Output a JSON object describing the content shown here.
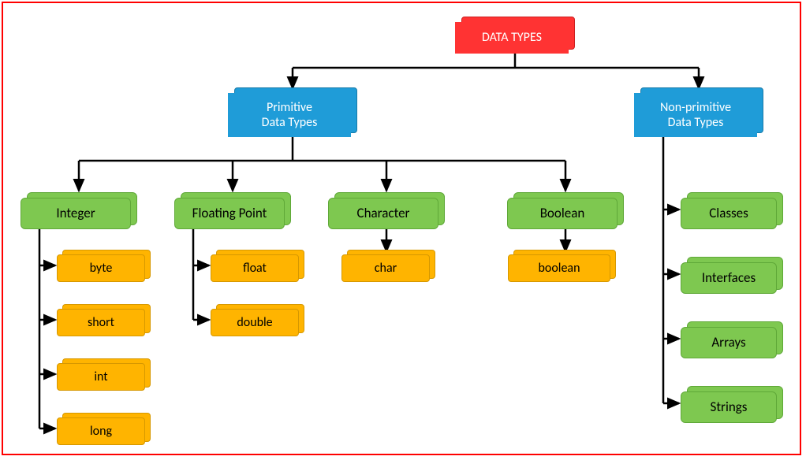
{
  "root": {
    "label": "DATA TYPES"
  },
  "primitive": {
    "label": "Primitive\nData Types",
    "integer": {
      "label": "Integer",
      "types": [
        "byte",
        "short",
        "int",
        "long"
      ]
    },
    "floating": {
      "label": "Floating Point",
      "types": [
        "float",
        "double"
      ]
    },
    "character": {
      "label": "Character",
      "types": [
        "char"
      ]
    },
    "boolean": {
      "label": "Boolean",
      "types": [
        "boolean"
      ]
    }
  },
  "nonprimitive": {
    "label": "Non-primitive\nData Types",
    "types": [
      "Classes",
      "Interfaces",
      "Arrays",
      "Strings"
    ]
  },
  "colors": {
    "root": "#ff3333",
    "category": "#1f9cd8",
    "group": "#7ec850",
    "leaf": "#ffb400"
  },
  "chart_data": {
    "type": "tree",
    "title": "DATA TYPES",
    "root": {
      "name": "DATA TYPES",
      "children": [
        {
          "name": "Primitive Data Types",
          "children": [
            {
              "name": "Integer",
              "children": [
                "byte",
                "short",
                "int",
                "long"
              ]
            },
            {
              "name": "Floating Point",
              "children": [
                "float",
                "double"
              ]
            },
            {
              "name": "Character",
              "children": [
                "char"
              ]
            },
            {
              "name": "Boolean",
              "children": [
                "boolean"
              ]
            }
          ]
        },
        {
          "name": "Non-primitive Data Types",
          "children": [
            "Classes",
            "Interfaces",
            "Arrays",
            "Strings"
          ]
        }
      ]
    }
  }
}
